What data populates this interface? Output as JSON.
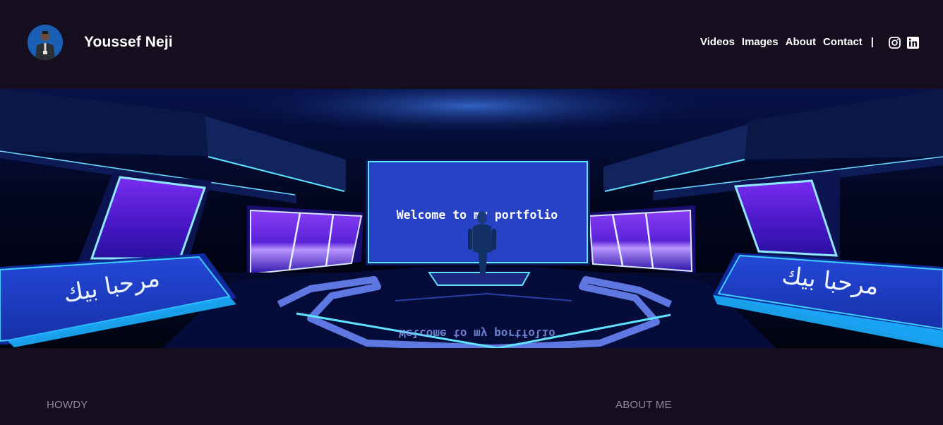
{
  "header": {
    "site_title": "Youssef Neji",
    "avatar_icon": "profile-photo"
  },
  "nav": {
    "links": [
      {
        "label": "Videos"
      },
      {
        "label": "Images"
      },
      {
        "label": "About"
      },
      {
        "label": "Contact"
      }
    ],
    "separator": "|",
    "social": [
      {
        "icon": "instagram-icon"
      },
      {
        "icon": "linkedin-icon"
      }
    ]
  },
  "hero": {
    "screen_text": "Welcome to my portfolio",
    "reflection_text": "Welcome to my portfolio",
    "left_panel_text": "مرحبا بيك",
    "right_panel_text": "مرحبا بيك",
    "colors": {
      "neon_cyan": "#5fe3ff",
      "panel_blue": "#2a3fd0",
      "purple": "#6a1fe0"
    }
  },
  "sections": {
    "left_heading": "HOWDY",
    "right_heading": "ABOUT ME"
  }
}
